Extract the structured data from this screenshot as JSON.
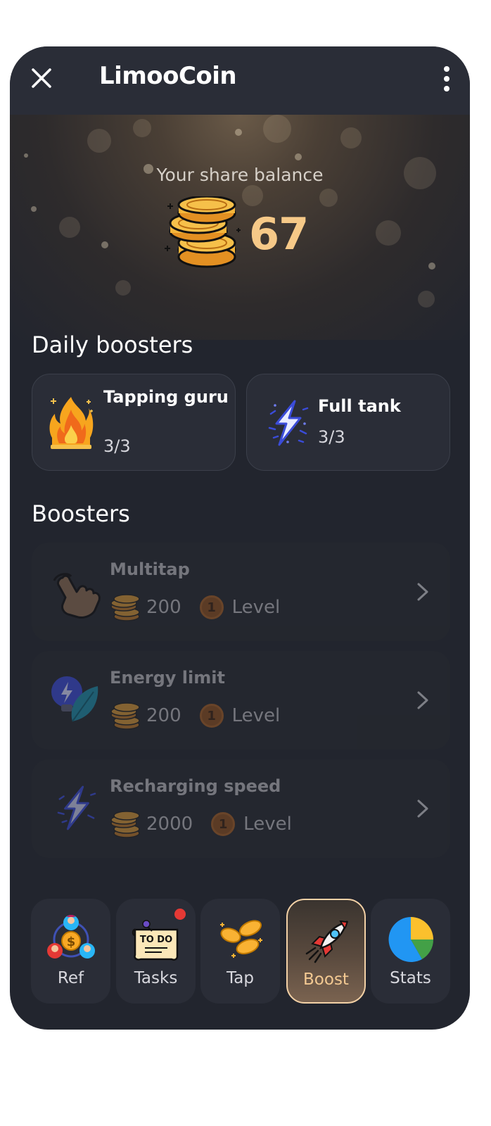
{
  "header": {
    "title": "LimooCoin"
  },
  "balance": {
    "label": "Your share balance",
    "value": "67"
  },
  "daily_boosters": {
    "title": "Daily boosters",
    "items": [
      {
        "name": "Tapping guru",
        "count": "3/3",
        "icon": "fire-icon"
      },
      {
        "name": "Full tank",
        "count": "3/3",
        "icon": "lightning-icon"
      }
    ]
  },
  "boosters": {
    "title": "Boosters",
    "items": [
      {
        "name": "Multitap",
        "cost": "200",
        "level_number": "1",
        "level_label": "Level",
        "icon": "tap-hand-icon"
      },
      {
        "name": "Energy limit",
        "cost": "200",
        "level_number": "1",
        "level_label": "Level",
        "icon": "bulb-leaf-icon"
      },
      {
        "name": "Recharging speed",
        "cost": "2000",
        "level_number": "1",
        "level_label": "Level",
        "icon": "lightning-icon"
      }
    ]
  },
  "nav": {
    "items": [
      {
        "label": "Ref",
        "icon": "referral-icon",
        "active": false
      },
      {
        "label": "Tasks",
        "icon": "todo-icon",
        "active": false,
        "notification": true
      },
      {
        "label": "Tap",
        "icon": "coins-icon",
        "active": false
      },
      {
        "label": "Boost",
        "icon": "rocket-icon",
        "active": true
      },
      {
        "label": "Stats",
        "icon": "pie-chart-icon",
        "active": false
      }
    ]
  },
  "colors": {
    "accent": "#f3c992",
    "background": "#22252e",
    "card": "#2a2d37",
    "notification": "#e53935"
  }
}
